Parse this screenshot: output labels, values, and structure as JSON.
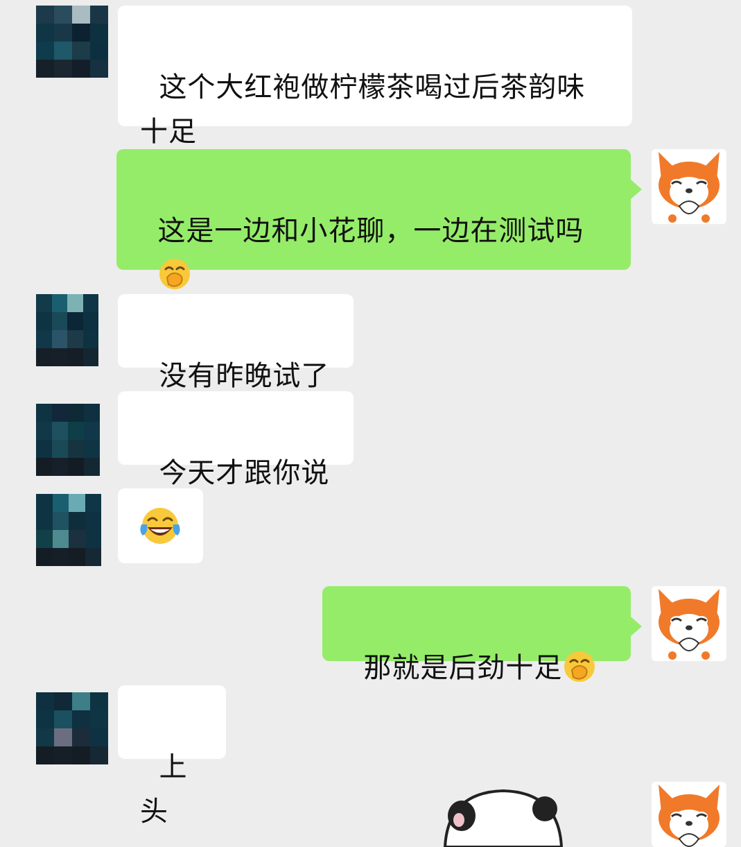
{
  "messages": [
    {
      "side": "left",
      "text": "这个大红袍做柠檬茶喝过后茶韵味十足"
    },
    {
      "side": "right",
      "text": "这是一边和小花聊，一边在测试吗",
      "emoji": "hand-over-mouth-emoji"
    },
    {
      "side": "left",
      "text": "没有昨晚试了"
    },
    {
      "side": "left",
      "text": "今天才跟你说"
    },
    {
      "side": "left",
      "emoji": "tears-of-joy-emoji"
    },
    {
      "side": "right",
      "text": "那就是后劲十足",
      "emoji": "hand-over-mouth-emoji"
    },
    {
      "side": "left",
      "text": "上头"
    },
    {
      "side": "right",
      "sticker": "panda-sticker"
    }
  ],
  "colors": {
    "background": "#ededed",
    "incoming_bubble": "#ffffff",
    "outgoing_bubble": "#95ec69"
  },
  "avatars": {
    "contact": "pixelated-avatar",
    "me": "fox-avatar"
  }
}
